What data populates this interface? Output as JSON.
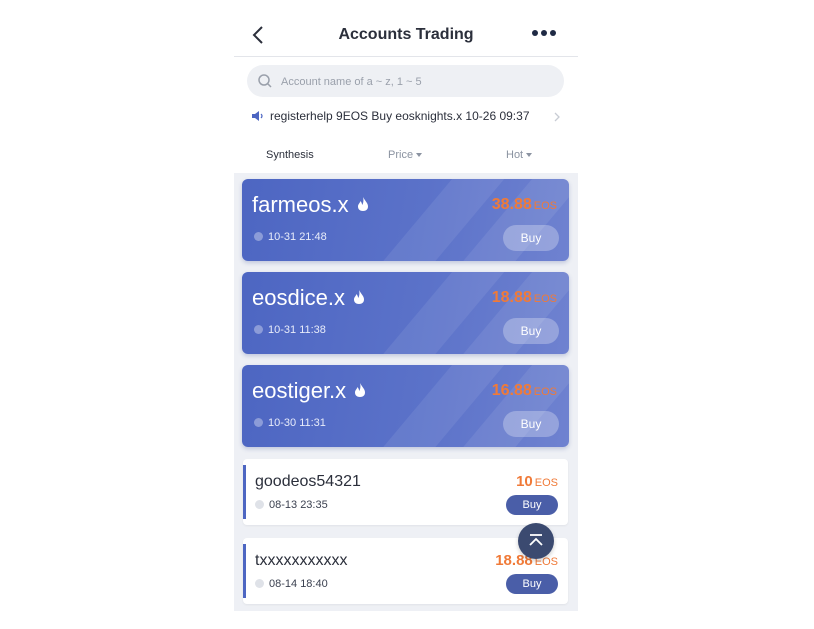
{
  "header": {
    "title": "Accounts Trading"
  },
  "search": {
    "placeholder": "Account name of a ~ z, 1 ~ 5"
  },
  "notice": {
    "text": "registerhelp 9EOS Buy eosknights.x 10-26 09:37"
  },
  "sort_tabs": [
    {
      "label": "Synthesis",
      "active": true
    },
    {
      "label": "Price",
      "active": false
    },
    {
      "label": "Hot",
      "active": false
    }
  ],
  "featured": [
    {
      "name": "farmeos.x",
      "time": "10-31 21:48",
      "price": "38.88",
      "unit": "EOS",
      "buy_label": "Buy"
    },
    {
      "name": "eosdice.x",
      "time": "10-31 11:38",
      "price": "18.88",
      "unit": "EOS",
      "buy_label": "Buy"
    },
    {
      "name": "eostiger.x",
      "time": "10-30 11:31",
      "price": "16.88",
      "unit": "EOS",
      "buy_label": "Buy"
    }
  ],
  "listings": [
    {
      "name": "goodeos54321",
      "time": "08-13 23:35",
      "price": "10",
      "unit": "EOS",
      "buy_label": "Buy"
    },
    {
      "name": "txxxxxxxxxxx",
      "time": "08-14 18:40",
      "price": "18.88",
      "unit": "EOS",
      "buy_label": "Buy"
    }
  ],
  "colors": {
    "accent": "#4d66c2",
    "price": "#f07a38",
    "buy_button": "#4a5ea8"
  },
  "icons": [
    "back-arrow-icon",
    "more-dots-icon",
    "search-icon",
    "speaker-icon",
    "chevron-right-icon",
    "caret-down-icon",
    "fire-icon",
    "clock-icon",
    "scroll-top-icon"
  ]
}
